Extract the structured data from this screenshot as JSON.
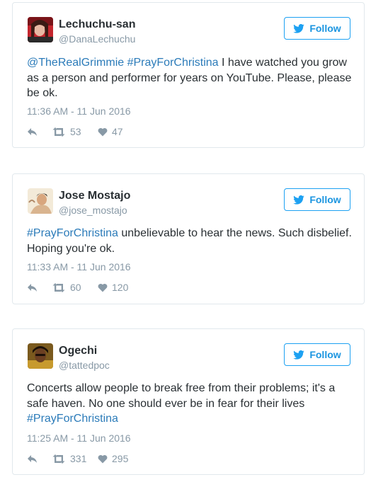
{
  "tweets": [
    {
      "name": "Lechuchu-san",
      "handle": "@DanaLechuchu",
      "follow_label": "Follow",
      "text_segments": [
        {
          "text": "@TheRealGrimmie",
          "type": "mention"
        },
        {
          "text": " ",
          "type": "plain"
        },
        {
          "text": "#PrayForChristina",
          "type": "hashtag"
        },
        {
          "text": " I have watched you grow as a person and performer for years on YouTube. Please, please be ok.",
          "type": "plain"
        }
      ],
      "timestamp": "11:36 AM - 11 Jun 2016",
      "retweets": "53",
      "likes": "47"
    },
    {
      "name": "Jose Mostajo",
      "handle": "@jose_mostajo",
      "follow_label": "Follow",
      "text_segments": [
        {
          "text": "#PrayForChristina",
          "type": "hashtag"
        },
        {
          "text": " unbelievable to hear the news. Such disbelief. Hoping you're ok.",
          "type": "plain"
        }
      ],
      "timestamp": "11:33 AM - 11 Jun 2016",
      "retweets": "60",
      "likes": "120"
    },
    {
      "name": "Ogechi",
      "handle": "@tattedpoc",
      "follow_label": "Follow",
      "text_segments": [
        {
          "text": "Concerts allow people to break free from their problems; it's a safe haven. No one should ever be in fear for their lives ",
          "type": "plain"
        },
        {
          "text": "#PrayForChristina",
          "type": "hashtag"
        }
      ],
      "timestamp": "11:25 AM - 11 Jun 2016",
      "retweets": "331",
      "likes": "295"
    }
  ],
  "colors": {
    "accent": "#1da1f2",
    "link": "#2b7bb9",
    "muted": "#8899a6",
    "text": "#292f33",
    "border": "#e1e8ed"
  },
  "icons": {
    "follow": "twitter-bird-icon",
    "reply": "reply-icon",
    "retweet": "retweet-icon",
    "like": "heart-icon"
  }
}
